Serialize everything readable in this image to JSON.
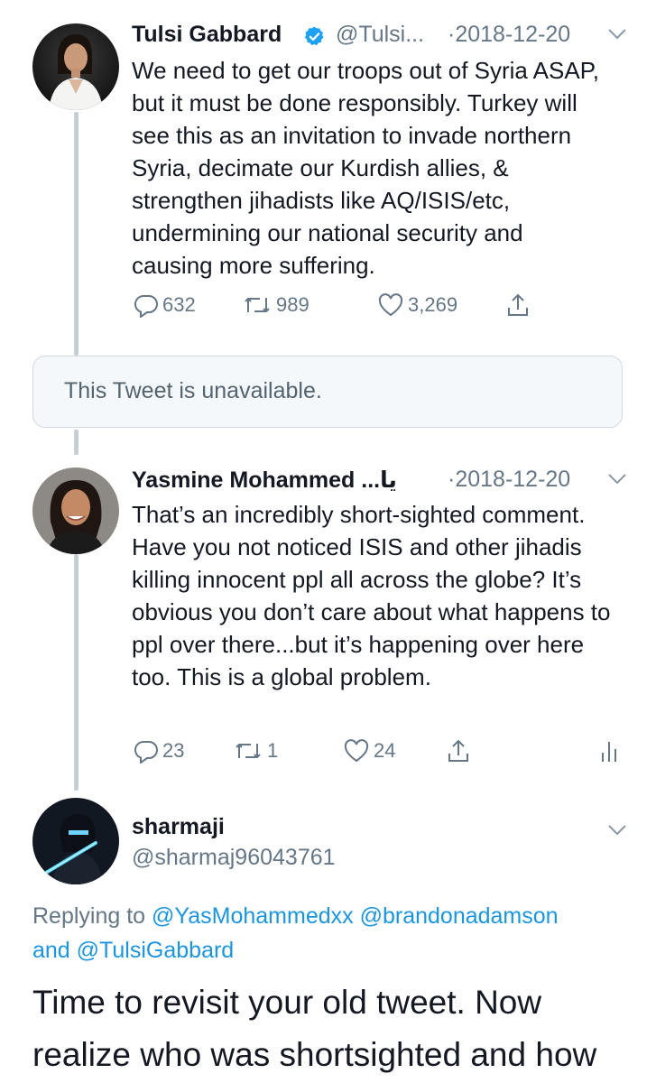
{
  "tweets": [
    {
      "name": "Tulsi Gabbard",
      "handle": "@Tulsi...",
      "date": "·2018-12-20",
      "text": "We need to get our troops out of Syria ASAP, but it must be done responsibly. Turkey will see this as an invitation to invade northern Syria, decimate our Kurdish allies, & strengthen jihadists like AQ/ISIS/etc, undermining our national security and causing more suffering.",
      "replies": "632",
      "retweets": "989",
      "likes": "3,269",
      "verified": true
    },
    {
      "name": "Yasmine Mohammed ...يا",
      "date": "·2018-12-20",
      "text": "That’s an incredibly short-sighted comment. Have you not noticed ISIS and other jihadis killing innocent ppl all across the globe? It’s obvious you don’t care about what happens to ppl over there...but it’s happening over here too. This is a global problem.",
      "replies": "23",
      "retweets": "1",
      "likes": "24"
    }
  ],
  "unavailable_text": "This Tweet is unavailable.",
  "focus_tweet": {
    "name": "sharmaji",
    "handle": "@sharmaj96043761",
    "replying_prefix": "Replying to",
    "replying_users": [
      "@YasMohammedxx",
      "@brandonadamson"
    ],
    "replying_and": "and",
    "replying_last": "@TulsiGabbard",
    "text_line1": "Time to revisit your old tweet. Now",
    "text_line2": "realize who was shortsighted and how"
  },
  "colors": {
    "accent": "#1b95e0",
    "verified": "#1da1f2",
    "muted": "#657786"
  }
}
